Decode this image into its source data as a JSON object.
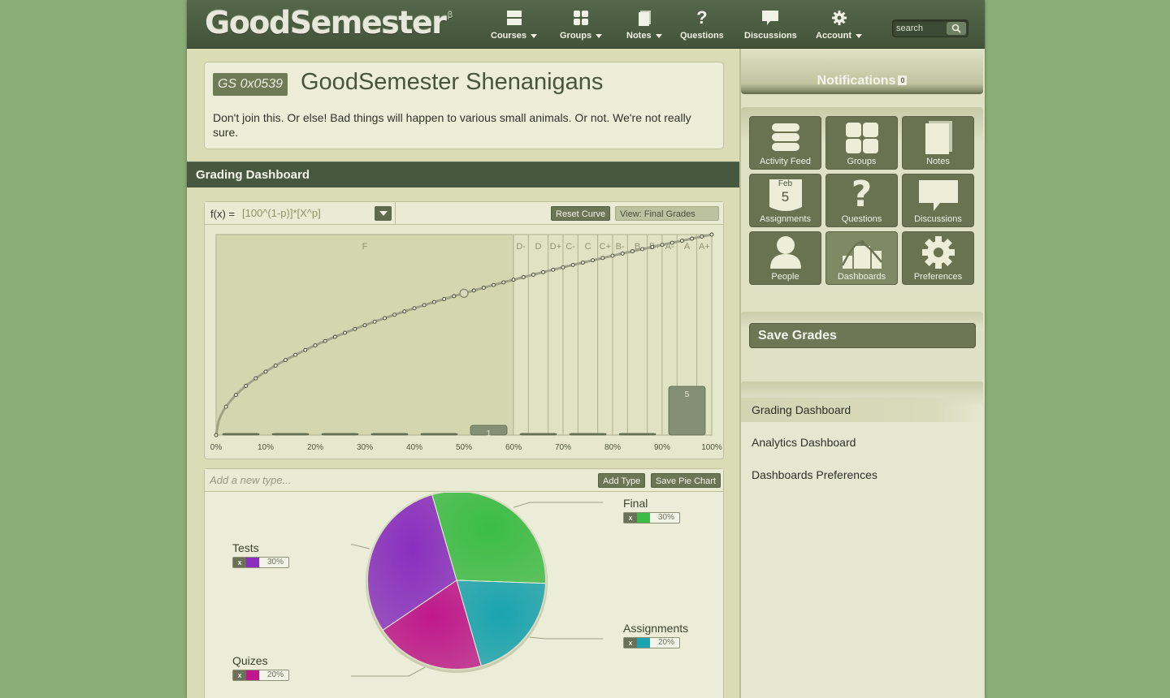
{
  "app": {
    "logo": "GoodSemester",
    "beta": "β"
  },
  "nav": {
    "items": [
      {
        "label": "Courses",
        "icon": "courses-icon",
        "dropdown": true
      },
      {
        "label": "Groups",
        "icon": "groups-icon",
        "dropdown": true
      },
      {
        "label": "Notes",
        "icon": "notes-icon",
        "dropdown": true
      },
      {
        "label": "Questions",
        "icon": "question-icon",
        "dropdown": false
      },
      {
        "label": "Discussions",
        "icon": "discussion-icon",
        "dropdown": false
      },
      {
        "label": "Account",
        "icon": "gear-icon",
        "dropdown": true
      }
    ],
    "search_placeholder": "search"
  },
  "course": {
    "code": "GS 0x0539",
    "title": "GoodSemester Shenanigans",
    "description": "Don't join this. Or else! Bad things will happen to various small animals. Or not. We're not really sure."
  },
  "section_title": "Grading Dashboard",
  "curve": {
    "fx_label": "f(x) =",
    "fx_value": "[100^(1-p)]*[X^p]",
    "reset_label": "Reset Curve",
    "view_label": "View: Final Grades"
  },
  "chart_data": {
    "type": "bar",
    "xlabels": [
      "0%",
      "10%",
      "20%",
      "30%",
      "40%",
      "50%",
      "60%",
      "70%",
      "80%",
      "90%",
      "100%"
    ],
    "grade_bands": [
      {
        "label": "F",
        "from": 0,
        "to": 60
      },
      {
        "label": "D-",
        "from": 60,
        "to": 63
      },
      {
        "label": "D",
        "from": 63,
        "to": 67
      },
      {
        "label": "D+",
        "from": 67,
        "to": 70
      },
      {
        "label": "C-",
        "from": 70,
        "to": 73
      },
      {
        "label": "C",
        "from": 73,
        "to": 77
      },
      {
        "label": "C+",
        "from": 77,
        "to": 80
      },
      {
        "label": "B-",
        "from": 80,
        "to": 83
      },
      {
        "label": "B",
        "from": 83,
        "to": 87
      },
      {
        "label": "B+",
        "from": 87,
        "to": 90
      },
      {
        "label": "A-",
        "from": 90,
        "to": 93
      },
      {
        "label": "A",
        "from": 93,
        "to": 97
      },
      {
        "label": "A+",
        "from": 97,
        "to": 100
      }
    ],
    "histogram_bins": [
      {
        "from": 0,
        "to": 10,
        "count": 0
      },
      {
        "from": 10,
        "to": 20,
        "count": 0
      },
      {
        "from": 20,
        "to": 30,
        "count": 0
      },
      {
        "from": 30,
        "to": 40,
        "count": 0
      },
      {
        "from": 40,
        "to": 50,
        "count": 0
      },
      {
        "from": 50,
        "to": 60,
        "count": 1
      },
      {
        "from": 60,
        "to": 70,
        "count": 0
      },
      {
        "from": 70,
        "to": 80,
        "count": 0
      },
      {
        "from": 80,
        "to": 90,
        "count": 0
      },
      {
        "from": 90,
        "to": 100,
        "count": 5
      }
    ],
    "curve_exponent": 0.5,
    "curve_handle_x": 50,
    "xlim": [
      0,
      100
    ],
    "ylim": [
      0,
      100
    ]
  },
  "pie": {
    "add_placeholder": "Add a new type...",
    "add_label": "Add Type",
    "save_label": "Save Pie Chart",
    "remove_label": "x",
    "slices": [
      {
        "name": "Final",
        "percent": 30,
        "pct_label": "30%",
        "color": "#3bbd45"
      },
      {
        "name": "Assignments",
        "percent": 20,
        "pct_label": "20%",
        "color": "#1aa4b0"
      },
      {
        "name": "Quizes",
        "percent": 20,
        "pct_label": "20%",
        "color": "#c0188c"
      },
      {
        "name": "Tests",
        "percent": 30,
        "pct_label": "30%",
        "color": "#8a2fc0"
      }
    ]
  },
  "sidebar": {
    "notifications_label": "Notifications",
    "notifications_count": "0",
    "apps": [
      {
        "label": "Activity Feed",
        "icon": "activity-feed-icon"
      },
      {
        "label": "Groups",
        "icon": "groups-icon"
      },
      {
        "label": "Notes",
        "icon": "notes-icon"
      },
      {
        "label": "Assignments",
        "icon": "calendar-icon",
        "month": "Feb",
        "day": "5"
      },
      {
        "label": "Questions",
        "icon": "question-icon"
      },
      {
        "label": "Discussions",
        "icon": "discussion-icon"
      },
      {
        "label": "People",
        "icon": "person-icon"
      },
      {
        "label": "Dashboards",
        "icon": "dashboard-icon"
      },
      {
        "label": "Preferences",
        "icon": "gear-icon"
      }
    ],
    "save_grades_label": "Save Grades",
    "dashboards": [
      {
        "label": "Grading Dashboard",
        "active": true
      },
      {
        "label": "Analytics Dashboard",
        "active": false
      },
      {
        "label": "Dashboards Preferences",
        "active": false
      }
    ]
  },
  "colors": {
    "accent": "#6b7252",
    "nav_bg": "#4c5e43",
    "page_bg": "#8aad77"
  }
}
